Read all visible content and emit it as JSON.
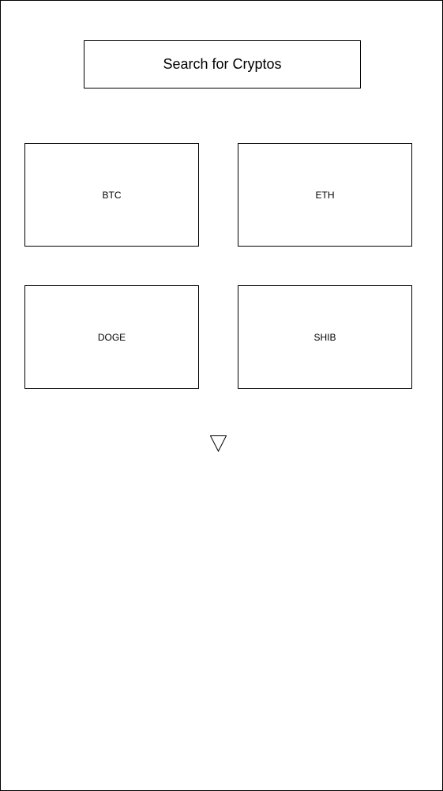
{
  "search": {
    "label": "Search for Cryptos"
  },
  "cryptos": [
    {
      "symbol": "BTC"
    },
    {
      "symbol": "ETH"
    },
    {
      "symbol": "DOGE"
    },
    {
      "symbol": "SHIB"
    }
  ],
  "expand": {
    "icon": "triangle-down-icon"
  },
  "colors": {
    "border": "#000000",
    "background": "#ffffff",
    "text": "#000000"
  }
}
